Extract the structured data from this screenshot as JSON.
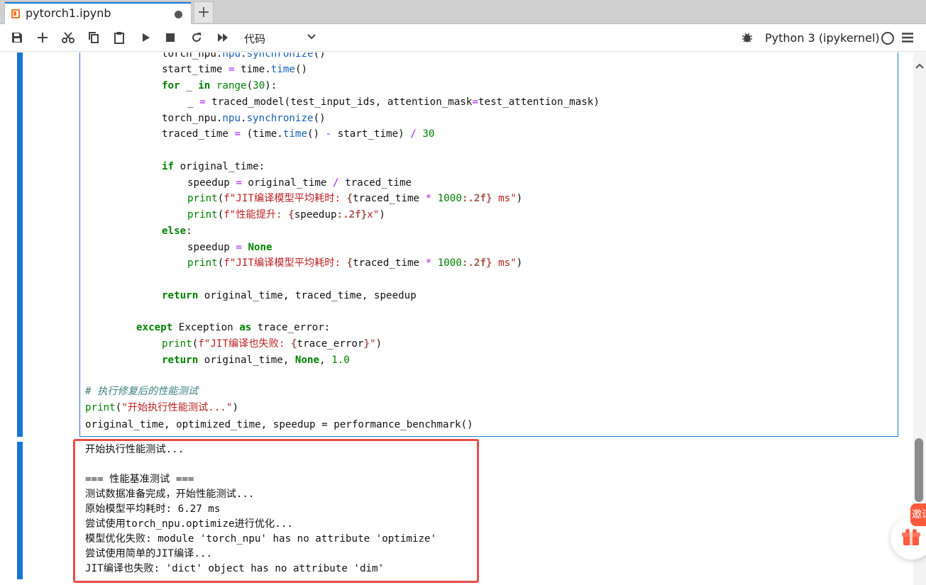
{
  "tab": {
    "title": "pytorch1.ipynb",
    "add_label": "+"
  },
  "toolbar": {
    "cell_type": "代码",
    "kernel_name": "Python 3 (ipykernel)"
  },
  "code_lines": [
    "torch_npu.npu.synchronize()",
    "start_time = time.time()",
    "for _ in range(30):",
    "_ = traced_model(test_input_ids, attention_mask=test_attention_mask)",
    "torch_npu.npu.synchronize()",
    "traced_time = (time.time() - start_time) / 30",
    "if original_time:",
    "speedup = original_time / traced_time",
    "print(f\"JIT编译模型平均耗时: {traced_time * 1000:.2f} ms\")",
    "print(f\"性能提升: {speedup:.2f}x\")",
    "else:",
    "speedup = None",
    "print(f\"JIT编译模型平均耗时: {traced_time * 1000:.2f} ms\")",
    "return original_time, traced_time, speedup",
    "except Exception as trace_error:",
    "print(f\"JIT编译也失败: {trace_error}\")",
    "return original_time, None, 1.0",
    "# 执行修复后的性能测试",
    "print(\"开始执行性能测试...\")",
    "original_time, optimized_time, speedup = performance_benchmark()"
  ],
  "output_lines": [
    "开始执行性能测试...",
    "",
    "=== 性能基准测试 ===",
    "测试数据准备完成，开始性能测试...",
    "原始模型平均耗时: 6.27 ms",
    "尝试使用torch_npu.optimize进行优化...",
    "模型优化失败: module 'torch_npu' has no attribute 'optimize'",
    "尝试使用简单的JIT编译...",
    "JIT编译也失败: 'dict' object has no attribute 'dim'"
  ],
  "widgets": {
    "invite_label": "邀请"
  },
  "colors": {
    "accent": "#1976d2",
    "highlight": "#e74c4c",
    "keyword": "#008000",
    "string": "#ba2121",
    "operator": "#aa22ff"
  }
}
